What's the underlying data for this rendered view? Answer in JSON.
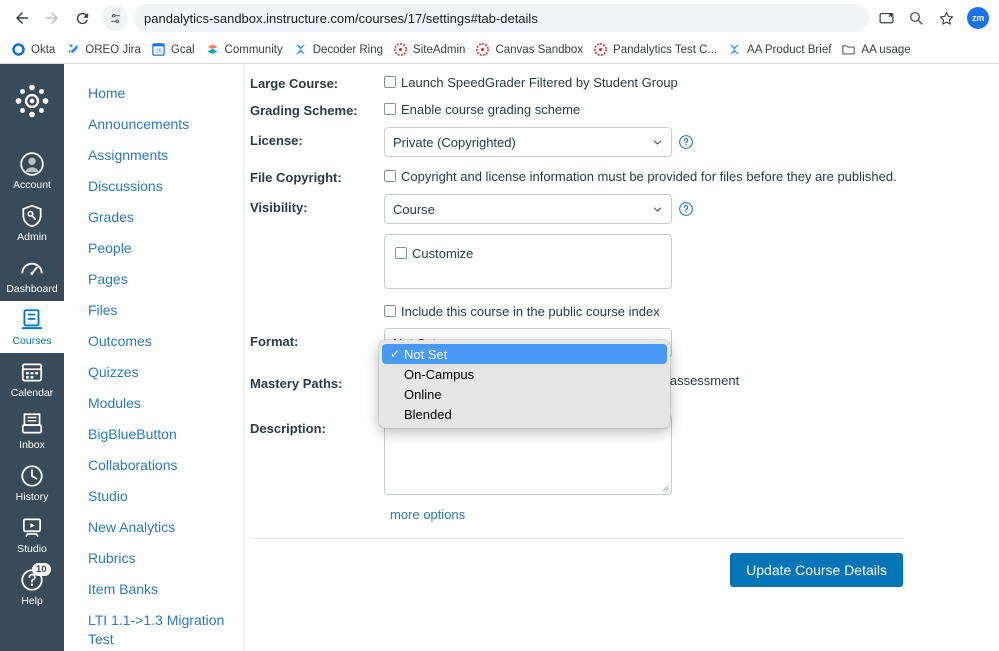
{
  "browser": {
    "back_icon": "back-arrow-icon",
    "forward_icon": "forward-arrow-icon",
    "reload_icon": "reload-icon",
    "tune_icon": "site-settings-icon",
    "url_host": "pandalytics-sandbox.instructure.com",
    "url_path": "/courses/17/settings#tab-details",
    "url_full": "pandalytics-sandbox.instructure.com/courses/17/settings#tab-details",
    "cast_icon": "cast-icon",
    "zoom_icon": "zoom-search-icon",
    "star_icon": "bookmark-star-icon",
    "avatar_initials": "zm",
    "avatar_color": "#1a73e8"
  },
  "bookmarks": [
    {
      "label": "Okta",
      "icon": "okta-icon",
      "color": "#0F6FDE"
    },
    {
      "label": "OREO Jira",
      "icon": "jira-icon",
      "color": "#2684FF"
    },
    {
      "label": "Gcal",
      "icon": "google-calendar-icon",
      "color": "#1A73E8"
    },
    {
      "label": "Community",
      "icon": "community-icon",
      "color": "#00A4BD"
    },
    {
      "label": "Decoder Ring",
      "icon": "decoder-ring-icon",
      "color": "#2196F3"
    },
    {
      "label": "SiteAdmin",
      "icon": "canvas-panda-icon",
      "color": "#E62429"
    },
    {
      "label": "Canvas Sandbox",
      "icon": "canvas-panda-icon",
      "color": "#E62429"
    },
    {
      "label": "Pandalytics Test C...",
      "icon": "canvas-panda-icon",
      "color": "#E62429"
    },
    {
      "label": "AA Product Brief",
      "icon": "decoder-ring-icon",
      "color": "#2196F3"
    },
    {
      "label": "AA usage",
      "icon": "folder-icon",
      "color": "#5f6368"
    }
  ],
  "global_nav": {
    "logo_icon": "canvas-logo-icon",
    "items": [
      {
        "label": "Account",
        "icon": "account-avatar-icon",
        "active": false
      },
      {
        "label": "Admin",
        "icon": "admin-shield-icon",
        "active": false
      },
      {
        "label": "Dashboard",
        "icon": "dashboard-gauge-icon",
        "active": false
      },
      {
        "label": "Courses",
        "icon": "courses-book-icon",
        "active": true
      },
      {
        "label": "Calendar",
        "icon": "calendar-icon",
        "active": false
      },
      {
        "label": "Inbox",
        "icon": "inbox-icon",
        "active": false
      },
      {
        "label": "History",
        "icon": "clock-history-icon",
        "active": false
      },
      {
        "label": "Studio",
        "icon": "studio-screen-icon",
        "active": false
      },
      {
        "label": "Help",
        "icon": "help-question-icon",
        "active": false,
        "badge": "10"
      }
    ]
  },
  "course_nav": {
    "items": [
      {
        "label": "Home"
      },
      {
        "label": "Announcements"
      },
      {
        "label": "Assignments"
      },
      {
        "label": "Discussions"
      },
      {
        "label": "Grades"
      },
      {
        "label": "People"
      },
      {
        "label": "Pages"
      },
      {
        "label": "Files"
      },
      {
        "label": "Outcomes"
      },
      {
        "label": "Quizzes"
      },
      {
        "label": "Modules"
      },
      {
        "label": "BigBlueButton"
      },
      {
        "label": "Collaborations"
      },
      {
        "label": "Studio"
      },
      {
        "label": "New Analytics"
      },
      {
        "label": "Rubrics"
      },
      {
        "label": "Item Banks"
      },
      {
        "label": "LTI 1.1->1.3 Migration Test"
      }
    ]
  },
  "form": {
    "large_course": {
      "label": "Large Course:",
      "checkbox_label": "Launch SpeedGrader Filtered by Student Group",
      "checked": false
    },
    "grading_scheme": {
      "label": "Grading Scheme:",
      "checkbox_label": "Enable course grading scheme",
      "checked": false
    },
    "license": {
      "label": "License:",
      "value": "Private (Copyrighted)",
      "help_icon": "help-circle-icon"
    },
    "file_copyright": {
      "label": "File Copyright:",
      "checkbox_label": "Copyright and license information must be provided for files before they are published.",
      "checked": false
    },
    "visibility": {
      "label": "Visibility:",
      "value": "Course",
      "help_icon": "help-circle-icon",
      "customize_label": "Customize",
      "customize_checked": false,
      "public_index_label": "Include this course in the public course index",
      "public_index_checked": false
    },
    "format": {
      "label": "Format:",
      "value": "Not Set",
      "options": [
        "Not Set",
        "On-Campus",
        "Online",
        "Blended"
      ],
      "selected_index": 0,
      "check_glyph": "✓"
    },
    "mastery_paths": {
      "label": "Mastery Paths:",
      "tail_text": "n assessment"
    },
    "description": {
      "label": "Description:",
      "value": ""
    },
    "more_options_label": "more options",
    "update_button_label": "Update Course Details",
    "update_button_color": "#0374B5"
  }
}
